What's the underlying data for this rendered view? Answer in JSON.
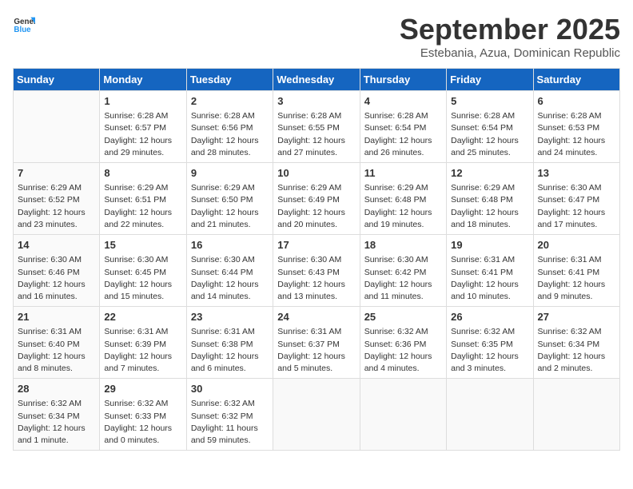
{
  "header": {
    "logo_general": "General",
    "logo_blue": "Blue",
    "title": "September 2025",
    "location": "Estebania, Azua, Dominican Republic"
  },
  "days_of_week": [
    "Sunday",
    "Monday",
    "Tuesday",
    "Wednesday",
    "Thursday",
    "Friday",
    "Saturday"
  ],
  "weeks": [
    [
      {
        "date": "",
        "info": ""
      },
      {
        "date": "1",
        "info": "Sunrise: 6:28 AM\nSunset: 6:57 PM\nDaylight: 12 hours\nand 29 minutes."
      },
      {
        "date": "2",
        "info": "Sunrise: 6:28 AM\nSunset: 6:56 PM\nDaylight: 12 hours\nand 28 minutes."
      },
      {
        "date": "3",
        "info": "Sunrise: 6:28 AM\nSunset: 6:55 PM\nDaylight: 12 hours\nand 27 minutes."
      },
      {
        "date": "4",
        "info": "Sunrise: 6:28 AM\nSunset: 6:54 PM\nDaylight: 12 hours\nand 26 minutes."
      },
      {
        "date": "5",
        "info": "Sunrise: 6:28 AM\nSunset: 6:54 PM\nDaylight: 12 hours\nand 25 minutes."
      },
      {
        "date": "6",
        "info": "Sunrise: 6:28 AM\nSunset: 6:53 PM\nDaylight: 12 hours\nand 24 minutes."
      }
    ],
    [
      {
        "date": "7",
        "info": "Sunrise: 6:29 AM\nSunset: 6:52 PM\nDaylight: 12 hours\nand 23 minutes."
      },
      {
        "date": "8",
        "info": "Sunrise: 6:29 AM\nSunset: 6:51 PM\nDaylight: 12 hours\nand 22 minutes."
      },
      {
        "date": "9",
        "info": "Sunrise: 6:29 AM\nSunset: 6:50 PM\nDaylight: 12 hours\nand 21 minutes."
      },
      {
        "date": "10",
        "info": "Sunrise: 6:29 AM\nSunset: 6:49 PM\nDaylight: 12 hours\nand 20 minutes."
      },
      {
        "date": "11",
        "info": "Sunrise: 6:29 AM\nSunset: 6:48 PM\nDaylight: 12 hours\nand 19 minutes."
      },
      {
        "date": "12",
        "info": "Sunrise: 6:29 AM\nSunset: 6:48 PM\nDaylight: 12 hours\nand 18 minutes."
      },
      {
        "date": "13",
        "info": "Sunrise: 6:30 AM\nSunset: 6:47 PM\nDaylight: 12 hours\nand 17 minutes."
      }
    ],
    [
      {
        "date": "14",
        "info": "Sunrise: 6:30 AM\nSunset: 6:46 PM\nDaylight: 12 hours\nand 16 minutes."
      },
      {
        "date": "15",
        "info": "Sunrise: 6:30 AM\nSunset: 6:45 PM\nDaylight: 12 hours\nand 15 minutes."
      },
      {
        "date": "16",
        "info": "Sunrise: 6:30 AM\nSunset: 6:44 PM\nDaylight: 12 hours\nand 14 minutes."
      },
      {
        "date": "17",
        "info": "Sunrise: 6:30 AM\nSunset: 6:43 PM\nDaylight: 12 hours\nand 13 minutes."
      },
      {
        "date": "18",
        "info": "Sunrise: 6:30 AM\nSunset: 6:42 PM\nDaylight: 12 hours\nand 11 minutes."
      },
      {
        "date": "19",
        "info": "Sunrise: 6:31 AM\nSunset: 6:41 PM\nDaylight: 12 hours\nand 10 minutes."
      },
      {
        "date": "20",
        "info": "Sunrise: 6:31 AM\nSunset: 6:41 PM\nDaylight: 12 hours\nand 9 minutes."
      }
    ],
    [
      {
        "date": "21",
        "info": "Sunrise: 6:31 AM\nSunset: 6:40 PM\nDaylight: 12 hours\nand 8 minutes."
      },
      {
        "date": "22",
        "info": "Sunrise: 6:31 AM\nSunset: 6:39 PM\nDaylight: 12 hours\nand 7 minutes."
      },
      {
        "date": "23",
        "info": "Sunrise: 6:31 AM\nSunset: 6:38 PM\nDaylight: 12 hours\nand 6 minutes."
      },
      {
        "date": "24",
        "info": "Sunrise: 6:31 AM\nSunset: 6:37 PM\nDaylight: 12 hours\nand 5 minutes."
      },
      {
        "date": "25",
        "info": "Sunrise: 6:32 AM\nSunset: 6:36 PM\nDaylight: 12 hours\nand 4 minutes."
      },
      {
        "date": "26",
        "info": "Sunrise: 6:32 AM\nSunset: 6:35 PM\nDaylight: 12 hours\nand 3 minutes."
      },
      {
        "date": "27",
        "info": "Sunrise: 6:32 AM\nSunset: 6:34 PM\nDaylight: 12 hours\nand 2 minutes."
      }
    ],
    [
      {
        "date": "28",
        "info": "Sunrise: 6:32 AM\nSunset: 6:34 PM\nDaylight: 12 hours\nand 1 minute."
      },
      {
        "date": "29",
        "info": "Sunrise: 6:32 AM\nSunset: 6:33 PM\nDaylight: 12 hours\nand 0 minutes."
      },
      {
        "date": "30",
        "info": "Sunrise: 6:32 AM\nSunset: 6:32 PM\nDaylight: 11 hours\nand 59 minutes."
      },
      {
        "date": "",
        "info": ""
      },
      {
        "date": "",
        "info": ""
      },
      {
        "date": "",
        "info": ""
      },
      {
        "date": "",
        "info": ""
      }
    ]
  ]
}
